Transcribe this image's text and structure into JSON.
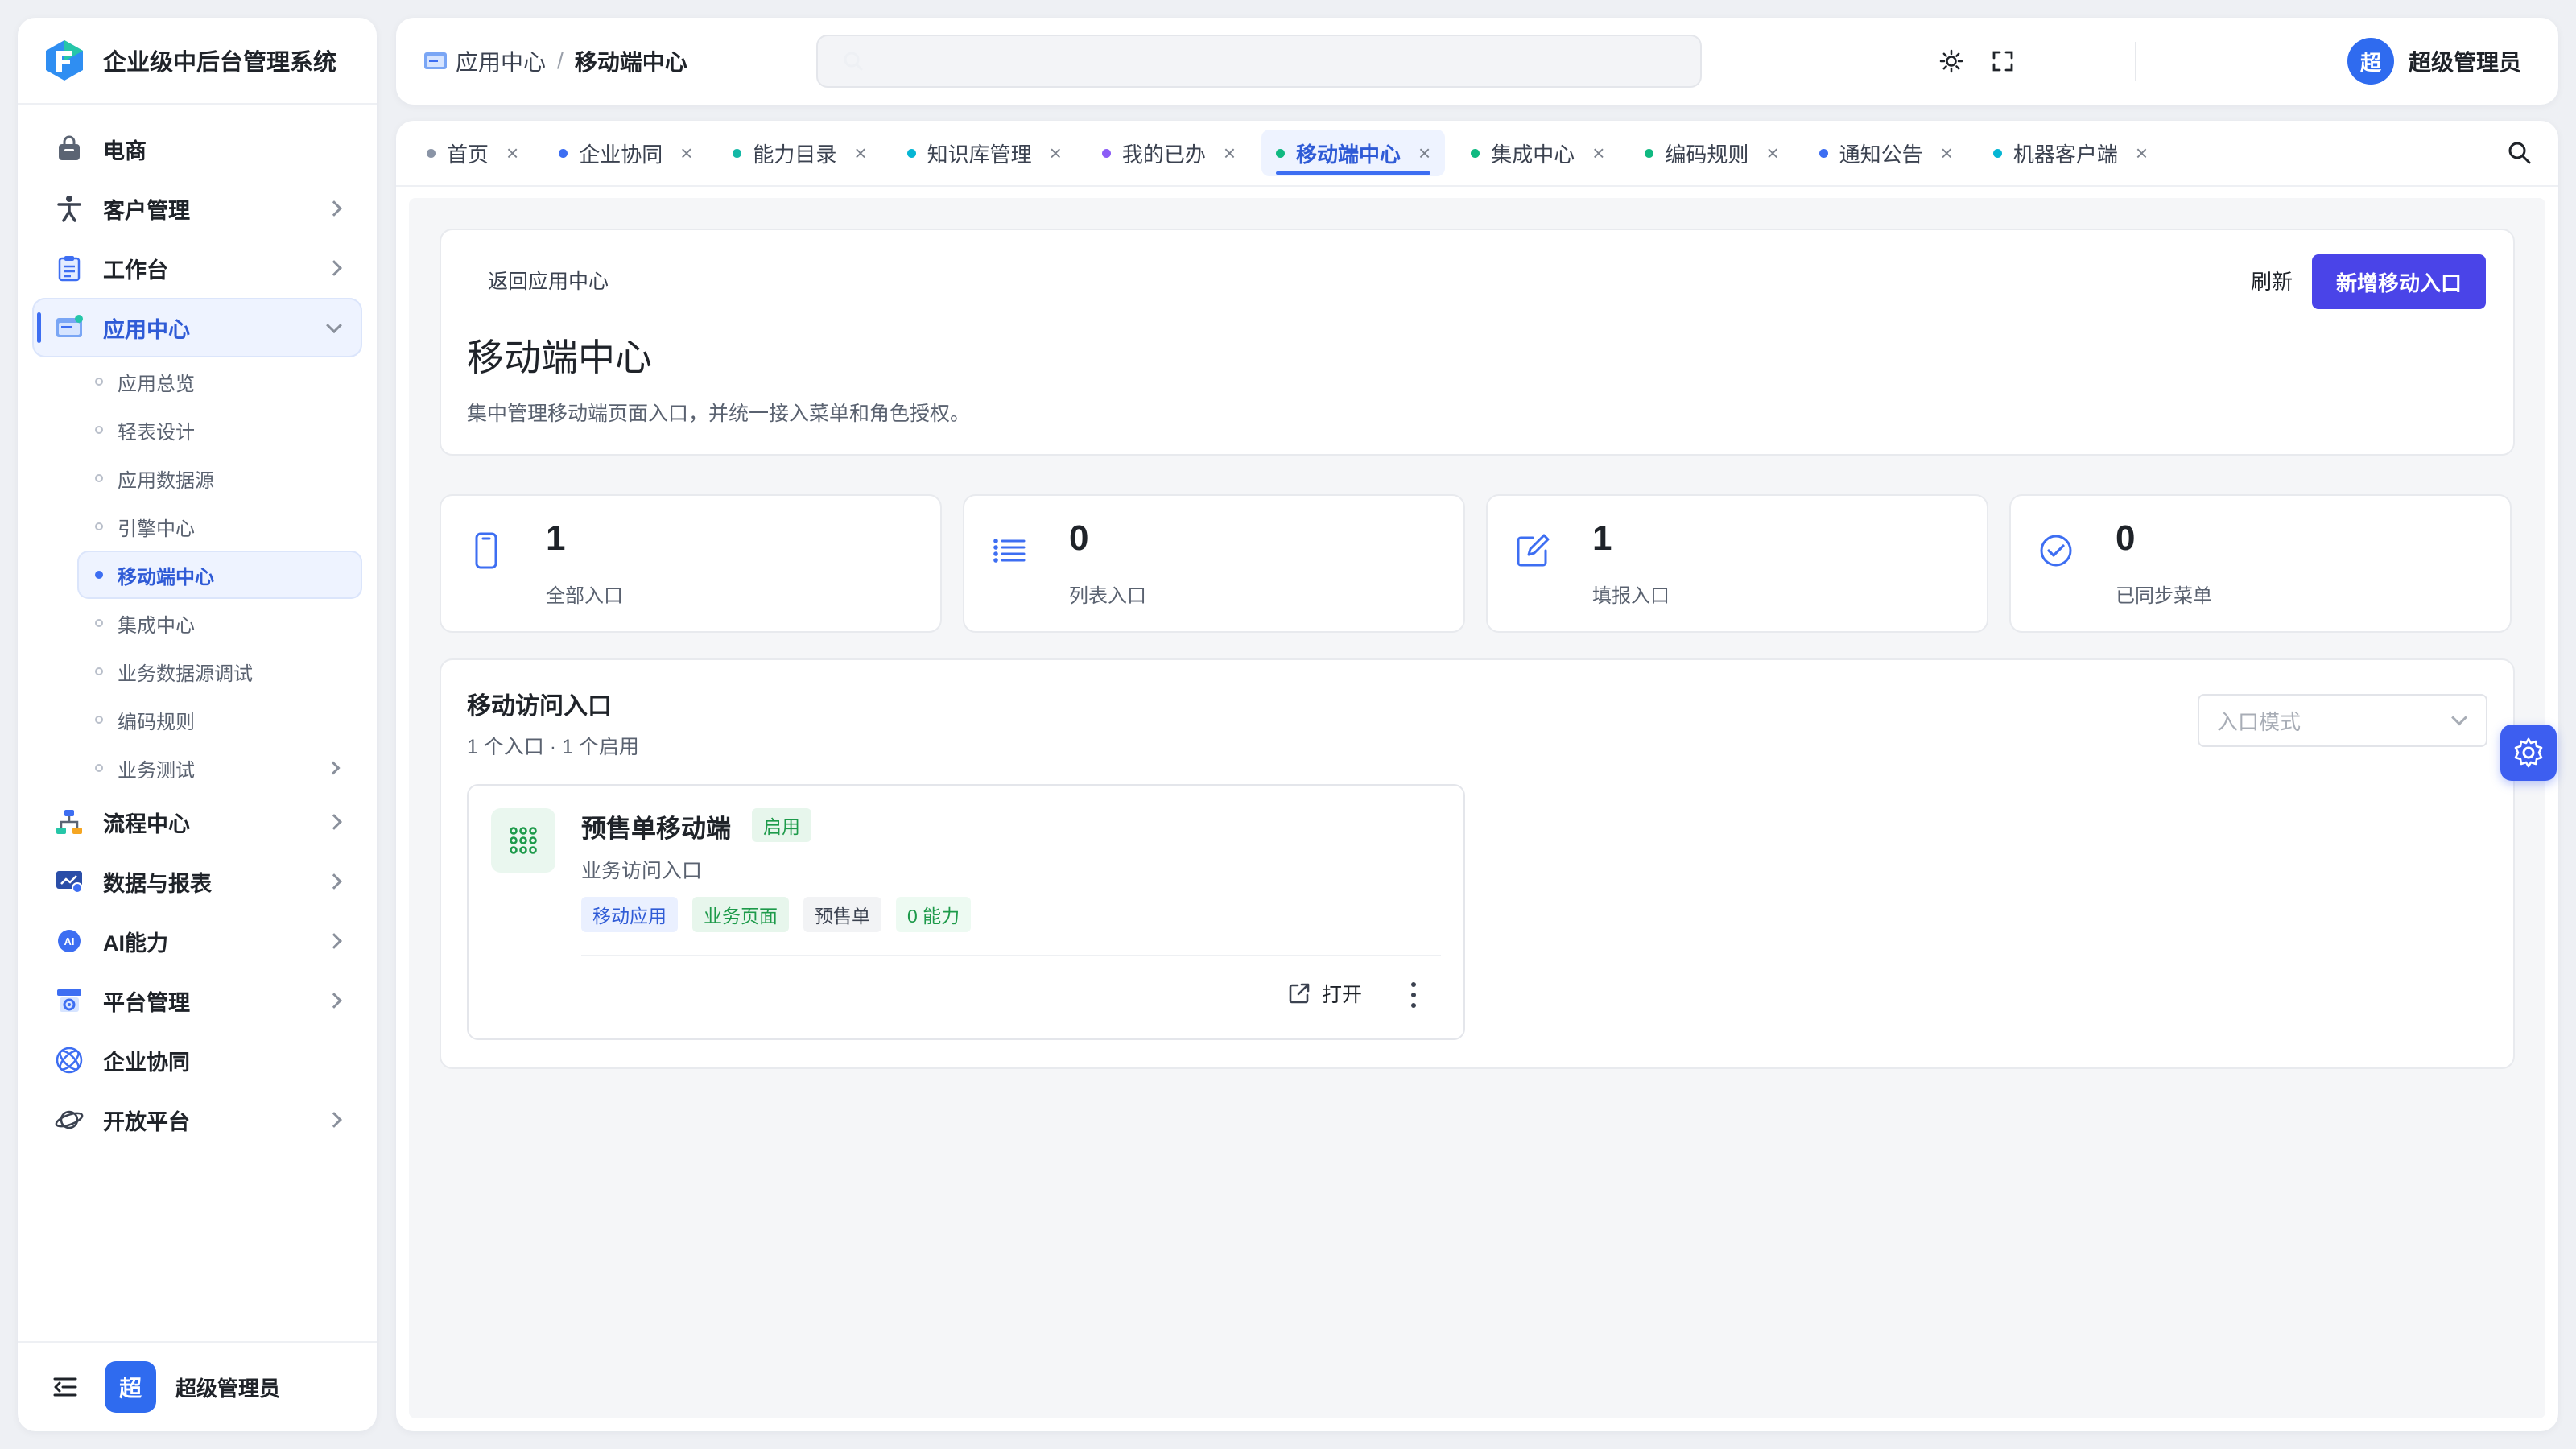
{
  "brand": {
    "title": "企业级中后台管理系统"
  },
  "sidebar": {
    "items": [
      {
        "label": "电商"
      },
      {
        "label": "客户管理"
      },
      {
        "label": "工作台"
      },
      {
        "label": "应用中心"
      },
      {
        "label": "流程中心"
      },
      {
        "label": "数据与报表"
      },
      {
        "label": "AI能力"
      },
      {
        "label": "平台管理"
      },
      {
        "label": "企业协同"
      },
      {
        "label": "开放平台"
      }
    ],
    "sub_items": [
      {
        "label": "应用总览"
      },
      {
        "label": "轻表设计"
      },
      {
        "label": "应用数据源"
      },
      {
        "label": "引擎中心"
      },
      {
        "label": "移动端中心"
      },
      {
        "label": "集成中心"
      },
      {
        "label": "业务数据源调试"
      },
      {
        "label": "编码规则"
      },
      {
        "label": "业务测试"
      }
    ],
    "footer": {
      "avatar": "超",
      "user": "超级管理员"
    }
  },
  "header": {
    "breadcrumb": {
      "parent": "应用中心",
      "separator": "/",
      "current": "移动端中心"
    },
    "search_placeholder": "",
    "user": {
      "avatar": "超",
      "name": "超级管理员"
    }
  },
  "tabs": [
    {
      "label": "首页",
      "color": "#8a94a6"
    },
    {
      "label": "企业协同",
      "color": "#3d6ef2"
    },
    {
      "label": "能力目录",
      "color": "#14b8a6"
    },
    {
      "label": "知识库管理",
      "color": "#06b6d4"
    },
    {
      "label": "我的已办",
      "color": "#8b5cf6"
    },
    {
      "label": "移动端中心",
      "color": "#10b981"
    },
    {
      "label": "集成中心",
      "color": "#10b981"
    },
    {
      "label": "编码规则",
      "color": "#10b981"
    },
    {
      "label": "通知公告",
      "color": "#3d6ef2"
    },
    {
      "label": "机器客户端",
      "color": "#06b6d4"
    }
  ],
  "tab_close": "×",
  "page": {
    "back": "返回应用中心",
    "title": "移动端中心",
    "description": "集中管理移动端页面入口，并统一接入菜单和角色授权。",
    "refresh": "刷新",
    "add": "新增移动入口"
  },
  "stats": [
    {
      "value": "1",
      "label": "全部入口",
      "icon": "phone-icon"
    },
    {
      "value": "0",
      "label": "列表入口",
      "icon": "list-icon"
    },
    {
      "value": "1",
      "label": "填报入口",
      "icon": "edit-icon"
    },
    {
      "value": "0",
      "label": "已同步菜单",
      "icon": "check-circle-icon"
    }
  ],
  "entries_section": {
    "title": "移动访问入口",
    "subtitle": "1 个入口 · 1 个启用",
    "mode_placeholder": "入口模式"
  },
  "entry": {
    "name": "预售单移动端",
    "status": "启用",
    "description": "业务访问入口",
    "tags": [
      {
        "label": "移动应用",
        "bg": "#eaf0ff",
        "color": "#2f5bd6"
      },
      {
        "label": "业务页面",
        "bg": "#e7f6ec",
        "color": "#1d9a4a"
      },
      {
        "label": "预售单",
        "bg": "#f2f3f5",
        "color": "#3b4250"
      },
      {
        "label": "0 能力",
        "bg": "#edfaf2",
        "color": "#1d9a4a"
      }
    ],
    "open": "打开"
  },
  "colors": {
    "accent": "#3d6ef2",
    "primary_button": "#4a44e8",
    "success": "#1d9a4a"
  }
}
